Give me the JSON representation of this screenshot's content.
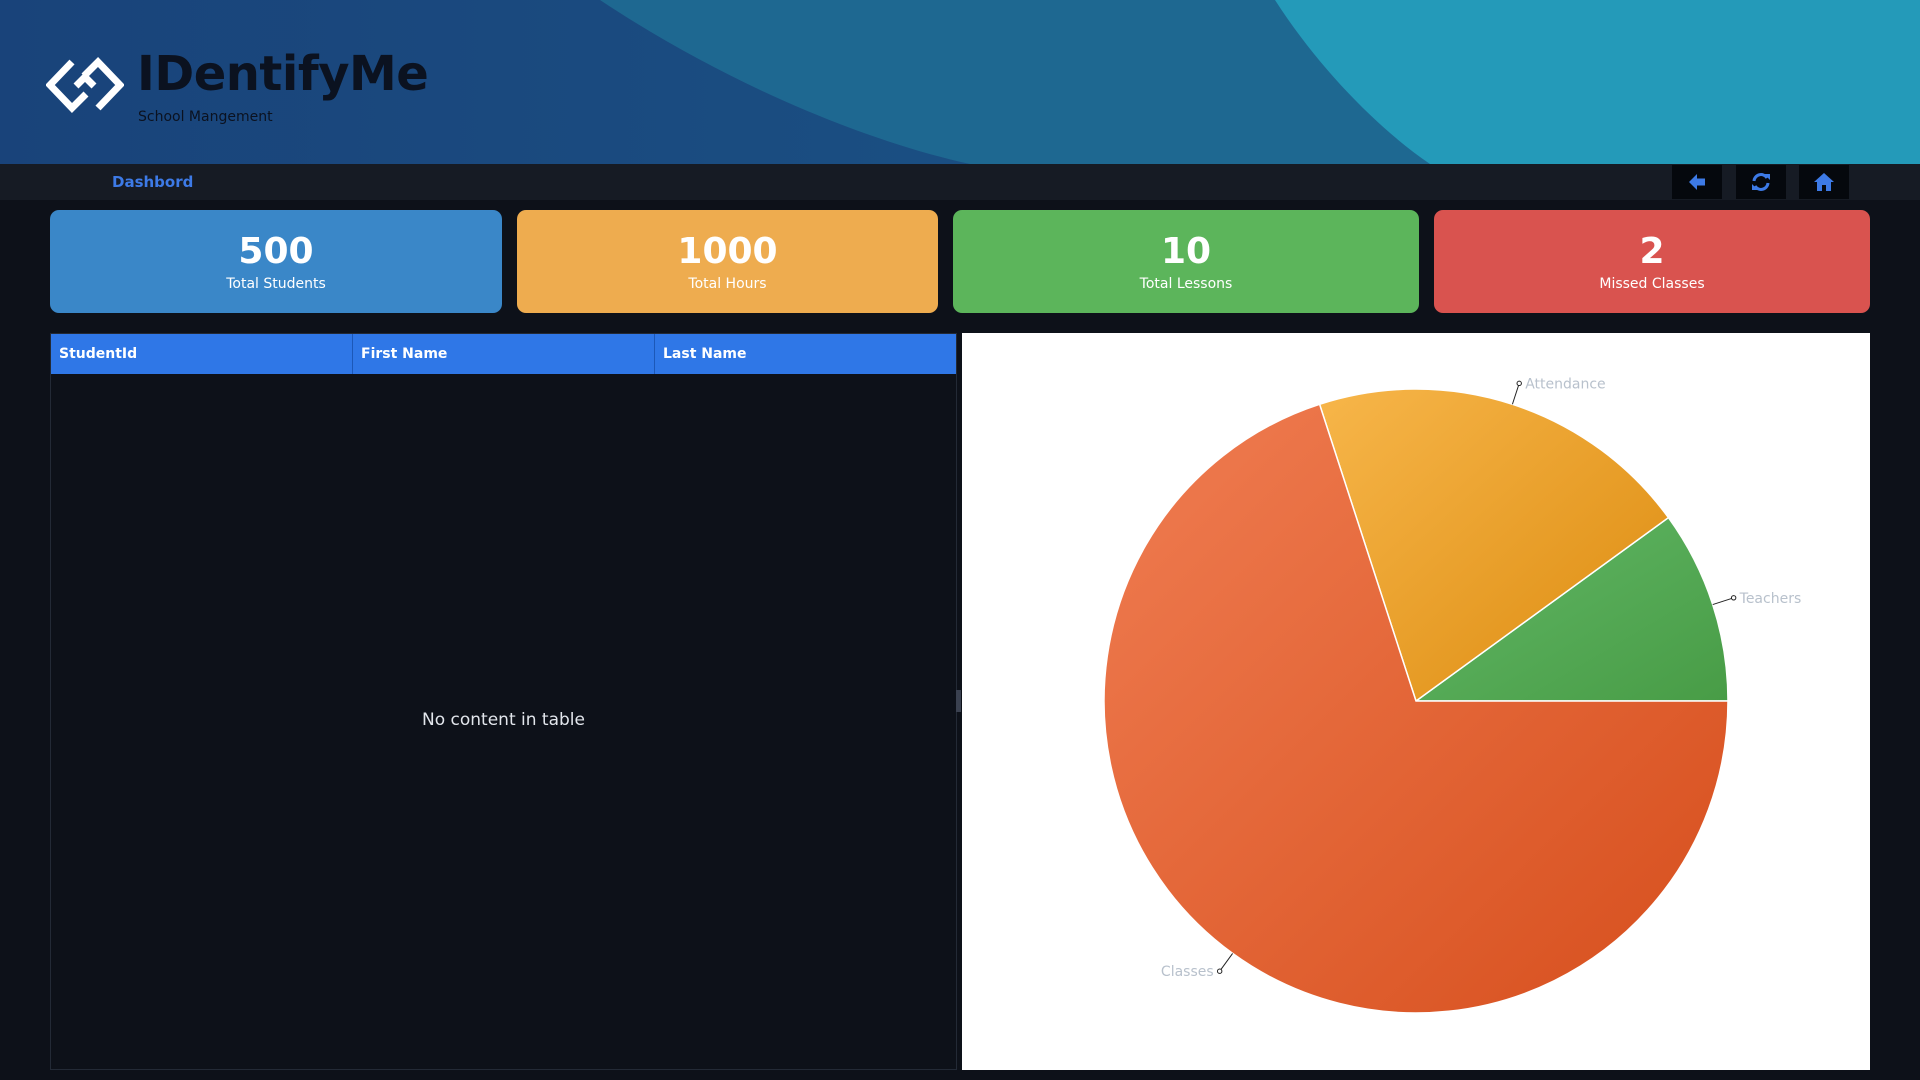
{
  "app": {
    "title": "IDentifyMe",
    "subtitle": "School Mangement"
  },
  "nav": {
    "breadcrumb": "Dashbord",
    "buttons": [
      {
        "icon": "arrow-left-icon"
      },
      {
        "icon": "refresh-icon"
      },
      {
        "icon": "home-icon"
      }
    ]
  },
  "colors": {
    "accent": "#3d7ae6",
    "header_blue": "#2f77e7",
    "card_blue": "#3a87c8",
    "card_orange": "#eeac4f",
    "card_green": "#5cb55b",
    "card_red": "#d9534f"
  },
  "stats": [
    {
      "value": "500",
      "label": "Total Students"
    },
    {
      "value": "1000",
      "label": "Total Hours"
    },
    {
      "value": "10",
      "label": "Total Lessons"
    },
    {
      "value": "2",
      "label": "Missed Classes"
    }
  ],
  "table": {
    "columns": [
      "StudentId",
      "First Name",
      "Last Name"
    ],
    "rows": [],
    "empty_message": "No content in table"
  },
  "chart_data": {
    "type": "pie",
    "title": "",
    "slices": [
      {
        "label": "Teachers",
        "share": 0.1,
        "color": "#53a953"
      },
      {
        "label": "Attendance",
        "share": 0.2,
        "color": "#e89c2a"
      },
      {
        "label": "Classes",
        "share": 0.7,
        "color": "#e3602f"
      }
    ]
  }
}
